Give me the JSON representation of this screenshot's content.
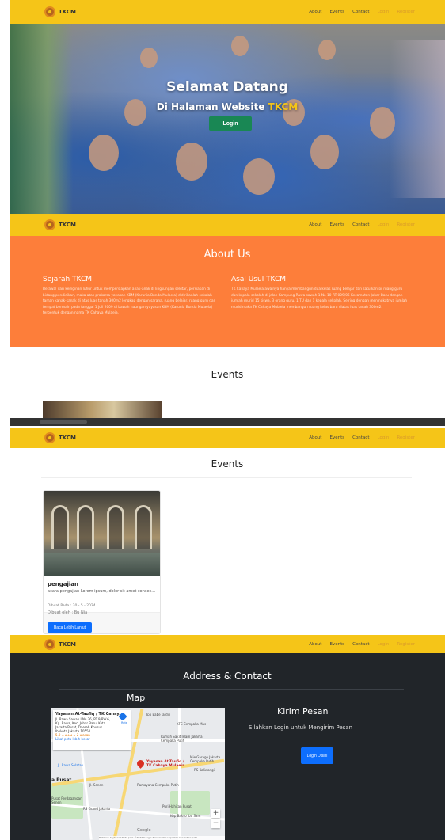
{
  "nav": {
    "brand": "TKCM",
    "links": [
      "About",
      "Events",
      "Contact",
      "Login",
      "Register"
    ]
  },
  "hero": {
    "title": "Selamat Datang",
    "subtitle": "Di Halaman Website",
    "subtitle_accent": "TKCM",
    "button": "Login"
  },
  "about": {
    "title": "About Us",
    "sejarah": {
      "heading": "Sejarah TKCM",
      "text": "Berawal dari keinginan luhur untuk mempersiapkan anak-anak di lingkungan sekitar, persiapan di bidang pendidikan, maka atas prakarsa yayasan KBM (Karunia Bunda Mulaeia) didirikanlah sekolah taman kanak-kanak di atas luas tanah 300m2 lengkap dengan sarana, ruang belajar, ruang guru dan tempat bermain pada tanggal 1 Juli 2009 di bawah naungan yayasan KBM (Karunia Bunda Mulaeia) terbentuk dengan nama TK Cahaya Mulaeia."
    },
    "asal": {
      "heading": "Asal Usul TKCM",
      "text": "TK Cahaya Mulaeia awalnya hanya membangun dua kelas ruang belajar dan satu kantor ruang guru dan kepala sekolah di jalan Kampung Rawa sawah 1 No 10 RT 009/06 Kecamatan Johar Baru dengan jumlah murid 15 siswa, 3 orang guru, 1 TU dan 1 kepala sekolah. Seiring dengan meningkatnya jumlah murid maka TK Cahaya Mulaeia membangun ruang kelas baru diatas luas tanah 300m2."
    }
  },
  "events": {
    "title": "Events",
    "card": {
      "title": "pengajian",
      "text": "acara pengajian Lorem ipsum, dolor sit amet consec...",
      "date": "Dibuat Pada : 30 - 5 - 2024",
      "author": "Dibuat oleh : Bu Nia",
      "button": "Baca Lebih Lanjut"
    }
  },
  "contact": {
    "title": "Address & Contact",
    "map_title": "Map",
    "map": {
      "place_name": "Yayasan At-Taufiq / TK Cahay...",
      "address_1": "Jl. Rawa Sawah I No.36, RT.9/RW.6,",
      "address_2": "Kp. Rawa, Kec. Johar Baru, Kota",
      "address_3": "Jakarta Pusat, Daerah Khusus",
      "address_4": "Ibukota Jakarta 10550",
      "rating": "5.0 ★★★★★ 2 ulasan",
      "view_larger": "Lihat peta lebih besar",
      "directions": "Rute",
      "pin_label": "Yayasan At-Taufiq / TK Cahaya Mulaeia",
      "labels": [
        "Ipo Babe Jardin",
        "KFC Cempaka Mas",
        "Rumah Sakit Islam Jakarta Cempaka Putih",
        "RS Grand Jakarta",
        "Ramayana Cempaka Putih",
        "Jl. Rawa Selatan",
        "Pusat Perdagangan Senen",
        "Mie Garage Jakarta Cempaka Putih",
        "RS Kaliwangi",
        "Puri Hahitan Pusat",
        "Jl. Senen",
        "Kop Bakso Ibu Sam"
      ],
      "area_label": "a Pusat",
      "footer": "Pintasan keyboard   Data peta ©2024 Google   Persyaratan   Laporkan kesalahan peta",
      "google": "Google"
    },
    "kirim_title": "Kirim Pesan",
    "kirim_sub": "Silahkan Login untuk Mengirim Pesan",
    "login_button": "Login Disini"
  },
  "colors": {
    "navbar": "#f5c518",
    "about_bg": "#fd7e3a",
    "contact_bg": "#212529",
    "login_green": "#198754",
    "primary_blue": "#0d6efd",
    "accent_text": "#f5c518"
  }
}
